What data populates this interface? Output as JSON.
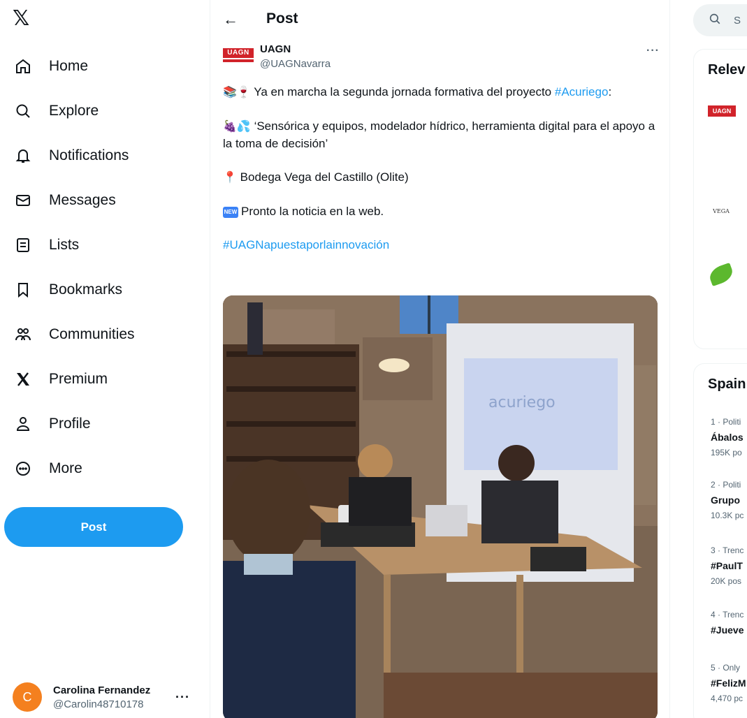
{
  "nav": {
    "logo": "𝕏",
    "items": [
      {
        "label": "Home",
        "icon": "home-icon"
      },
      {
        "label": "Explore",
        "icon": "search-icon"
      },
      {
        "label": "Notifications",
        "icon": "bell-icon"
      },
      {
        "label": "Messages",
        "icon": "envelope-icon"
      },
      {
        "label": "Lists",
        "icon": "list-icon"
      },
      {
        "label": "Bookmarks",
        "icon": "bookmark-icon"
      },
      {
        "label": "Communities",
        "icon": "people-icon"
      },
      {
        "label": "Premium",
        "icon": "x-logo-icon"
      },
      {
        "label": "Profile",
        "icon": "person-icon"
      },
      {
        "label": "More",
        "icon": "more-circle-icon"
      }
    ],
    "post_button": "Post",
    "account": {
      "initial": "C",
      "name": "Carolina Fernandez",
      "handle": "@Carolin48710178",
      "more": "···"
    }
  },
  "main": {
    "header_title": "Post",
    "back_icon": "←",
    "author": {
      "logo_text": "UAGN",
      "name": "UAGN",
      "handle": "@UAGNavarra",
      "more": "···"
    },
    "tweet": {
      "line1_emoji": "📚🍷",
      "line1_text": " Ya en marcha la segunda jornada formativa del proyecto ",
      "line1_hashtag": "#Acuriego",
      "line1_end": ":",
      "line2_emoji": "🍇💦",
      "line2_text": " ‘Sensórica y equipos, modelador hídrico, herramienta digital para el apoyo a la toma de decisión’",
      "line3_emoji": "📍",
      "line3_text": " Bodega Vega del Castillo (Olite)",
      "line4_badge": "NEW",
      "line4_text": "Pronto la noticia en la web.",
      "hashtag": "#UAGNapuestaporlainnovación"
    },
    "media": {
      "screen_text": "acuriego"
    }
  },
  "right": {
    "search_placeholder": "S",
    "relevant_title": "Relev",
    "relevant_logos": [
      "UAGN",
      "VEGA"
    ],
    "trends_title": "Spain",
    "trends": [
      {
        "meta": "1 · Politi",
        "title": "Ábalos",
        "count": "195K po"
      },
      {
        "meta": "2 · Politi",
        "title": "Grupo",
        "count": "10.3K pc"
      },
      {
        "meta": "3 · Trenc",
        "title": "#PaulT",
        "count": "20K pos"
      },
      {
        "meta": "4 · Trenc",
        "title": "#Jueve",
        "count": ""
      },
      {
        "meta": "5 · Only",
        "title": "#FelizM",
        "count": "4,470 pc"
      }
    ]
  }
}
